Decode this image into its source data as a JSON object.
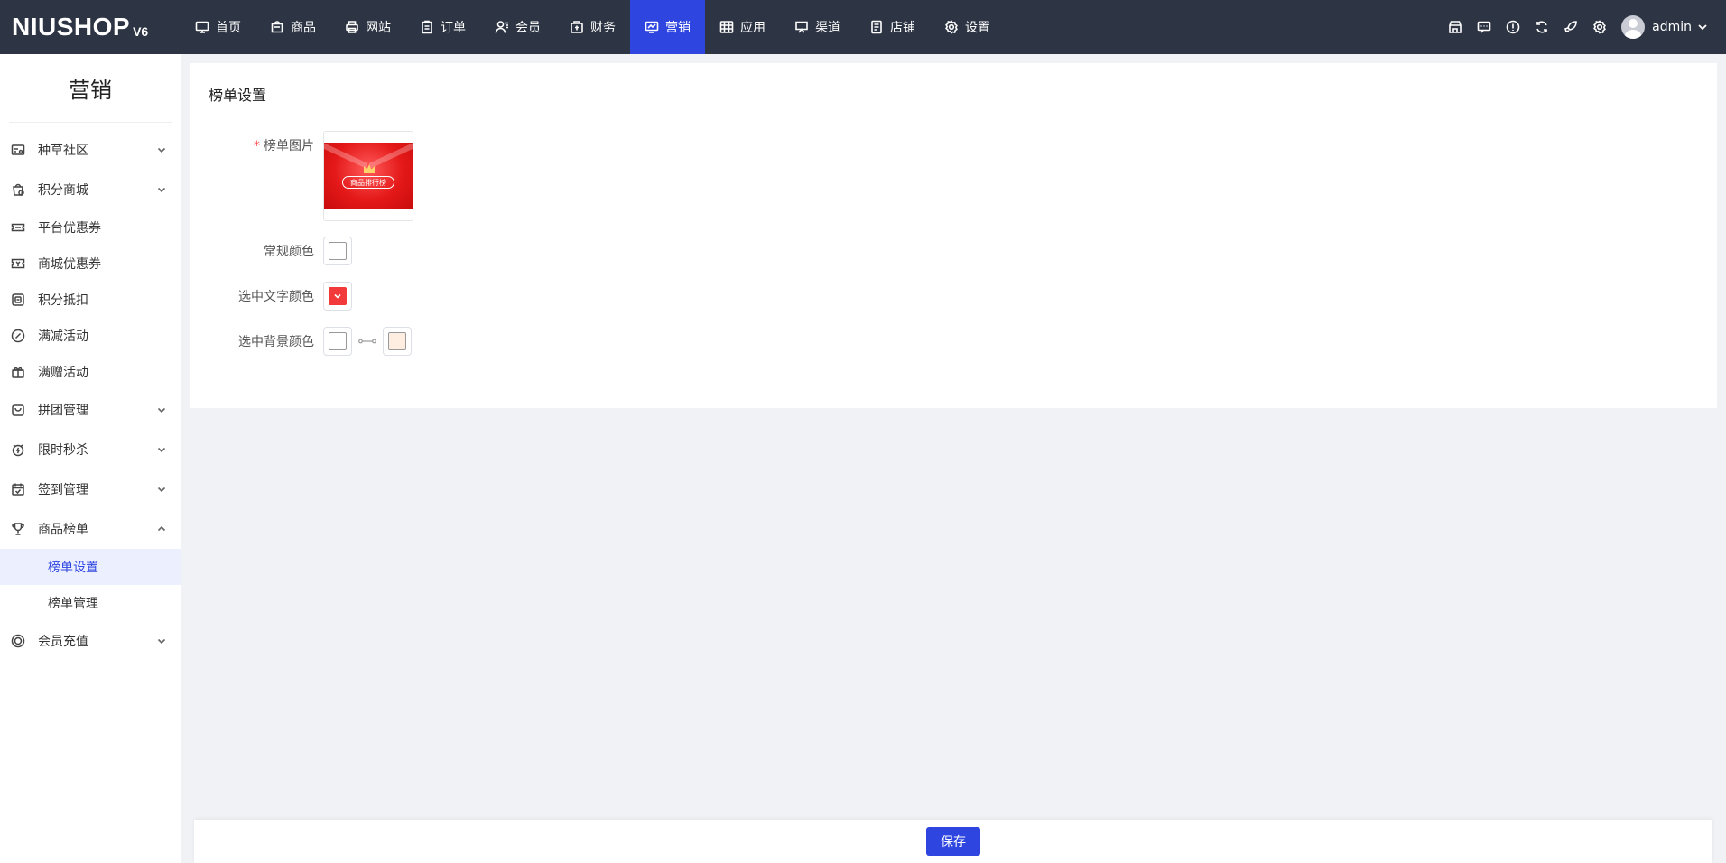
{
  "brand": {
    "name": "NIUSHOP",
    "version": "V6"
  },
  "nav": [
    {
      "label": "首页",
      "icon": "monitor-icon"
    },
    {
      "label": "商品",
      "icon": "bag-icon"
    },
    {
      "label": "网站",
      "icon": "printer-icon"
    },
    {
      "label": "订单",
      "icon": "clipboard-icon"
    },
    {
      "label": "会员",
      "icon": "user-icon"
    },
    {
      "label": "财务",
      "icon": "wallet-icon"
    },
    {
      "label": "营销",
      "icon": "marketing-icon",
      "active": true
    },
    {
      "label": "应用",
      "icon": "grid-icon"
    },
    {
      "label": "渠道",
      "icon": "channel-icon"
    },
    {
      "label": "店铺",
      "icon": "store-icon"
    },
    {
      "label": "设置",
      "icon": "gear-icon"
    }
  ],
  "top_right": {
    "icons": [
      "shop-icon",
      "message-icon",
      "info-icon",
      "refresh-icon",
      "rocket-icon",
      "gear-icon"
    ],
    "username": "admin"
  },
  "sidebar": {
    "title": "营销",
    "items": [
      {
        "label": "种草社区",
        "icon": "community-icon",
        "expandable": true
      },
      {
        "label": "积分商城",
        "icon": "points-mall-icon",
        "expandable": true
      },
      {
        "label": "平台优惠券",
        "icon": "coupon-icon"
      },
      {
        "label": "商城优惠券",
        "icon": "ticket-icon"
      },
      {
        "label": "积分抵扣",
        "icon": "deduct-icon"
      },
      {
        "label": "满减活动",
        "icon": "discount-icon"
      },
      {
        "label": "满赠活动",
        "icon": "gift-icon"
      },
      {
        "label": "拼团管理",
        "icon": "group-buy-icon",
        "expandable": true
      },
      {
        "label": "限时秒杀",
        "icon": "flash-sale-icon",
        "expandable": true
      },
      {
        "label": "签到管理",
        "icon": "calendar-icon",
        "expandable": true
      },
      {
        "label": "商品榜单",
        "icon": "trophy-icon",
        "expandable": true,
        "expanded": true,
        "children": [
          {
            "label": "榜单设置",
            "active": true
          },
          {
            "label": "榜单管理"
          }
        ]
      },
      {
        "label": "会员充值",
        "icon": "recharge-icon",
        "expandable": true
      }
    ]
  },
  "main": {
    "title": "榜单设置",
    "fields": {
      "image": {
        "label": "榜单图片",
        "required": "*",
        "banner_text": "商品排行榜"
      },
      "normal_color": {
        "label": "常规颜色",
        "color": "#ffffff"
      },
      "selected_text_color": {
        "label": "选中文字颜色",
        "color": "#f23a3a"
      },
      "selected_bg_color": {
        "label": "选中背景颜色",
        "color_start": "#ffffff",
        "color_end": "#fdeee1"
      }
    }
  },
  "footer": {
    "save_label": "保存"
  },
  "colors": {
    "topbar": "#2d3443",
    "accent": "#2e45e0",
    "active_bg": "#eceffe"
  }
}
